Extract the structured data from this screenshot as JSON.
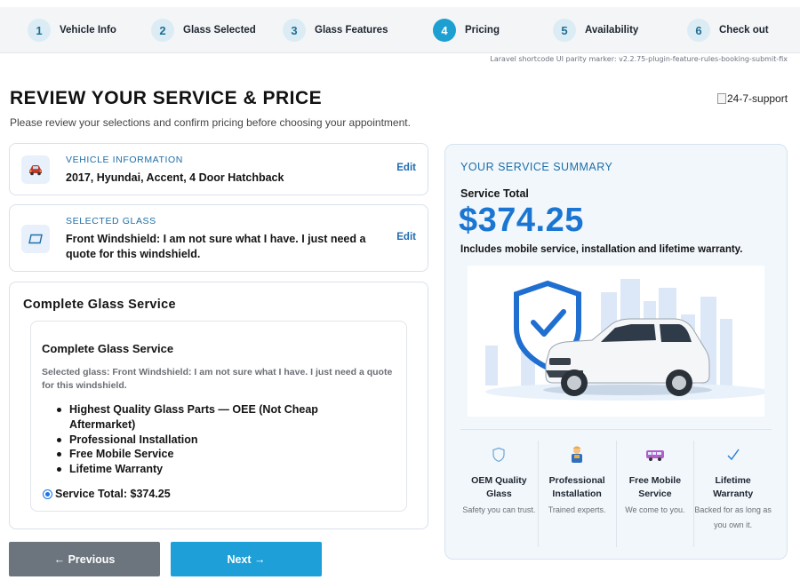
{
  "stepper": {
    "steps": [
      {
        "num": "1",
        "label": "Vehicle Info"
      },
      {
        "num": "2",
        "label": "Glass Selected"
      },
      {
        "num": "3",
        "label": "Glass Features"
      },
      {
        "num": "4",
        "label": "Pricing",
        "active": true
      },
      {
        "num": "5",
        "label": "Availability"
      },
      {
        "num": "6",
        "label": "Check out"
      }
    ],
    "marker": "Laravel shortcode UI parity marker: v2.2.75-plugin-feature-rules-booking-submit-fix"
  },
  "header": {
    "title": "REVIEW YOUR SERVICE & PRICE",
    "subtitle": "Please review your selections and confirm pricing before choosing your appointment.",
    "support_alt": "24-7-support"
  },
  "vehicle": {
    "kicker": "VEHICLE INFORMATION",
    "value": "2017, Hyundai, Accent, 4 Door Hatchback",
    "edit": "Edit"
  },
  "glass": {
    "kicker": "SELECTED GLASS",
    "value": "Front Windshield: I am not sure what I have. I just need a quote for this windshield.",
    "edit": "Edit"
  },
  "service": {
    "title": "Complete Glass Service",
    "inner_title": "Complete Glass Service",
    "description": "Selected glass: Front Windshield: I am not sure what I have. I just need a quote for this windshield.",
    "features": [
      "Highest Quality Glass Parts — OEE (Not Cheap Aftermarket)",
      "Professional Installation",
      "Free Mobile Service",
      "Lifetime Warranty"
    ],
    "total_label": "Service Total: $374.25"
  },
  "nav": {
    "previous": "← Previous",
    "next": "Next →"
  },
  "summary": {
    "kicker": "YOUR SERVICE SUMMARY",
    "label": "Service Total",
    "price": "$374.25",
    "note": "Includes mobile service, installation and lifetime warranty.",
    "features": [
      {
        "icon": "shield-icon",
        "title": "OEM Quality Glass",
        "desc": "Safety you can trust."
      },
      {
        "icon": "technician-icon",
        "title": "Professional Installation",
        "desc": "Trained experts."
      },
      {
        "icon": "van-icon",
        "title": "Free Mobile Service",
        "desc": "We come to you."
      },
      {
        "icon": "checkmark-icon",
        "title": "Lifetime Warranty",
        "desc": "Backed for as long as you own it."
      }
    ]
  },
  "colors": {
    "accent": "#1e9fd2",
    "price": "#1a76d2",
    "prev_button": "#6c757d",
    "next_button": "#1e9fd8"
  }
}
